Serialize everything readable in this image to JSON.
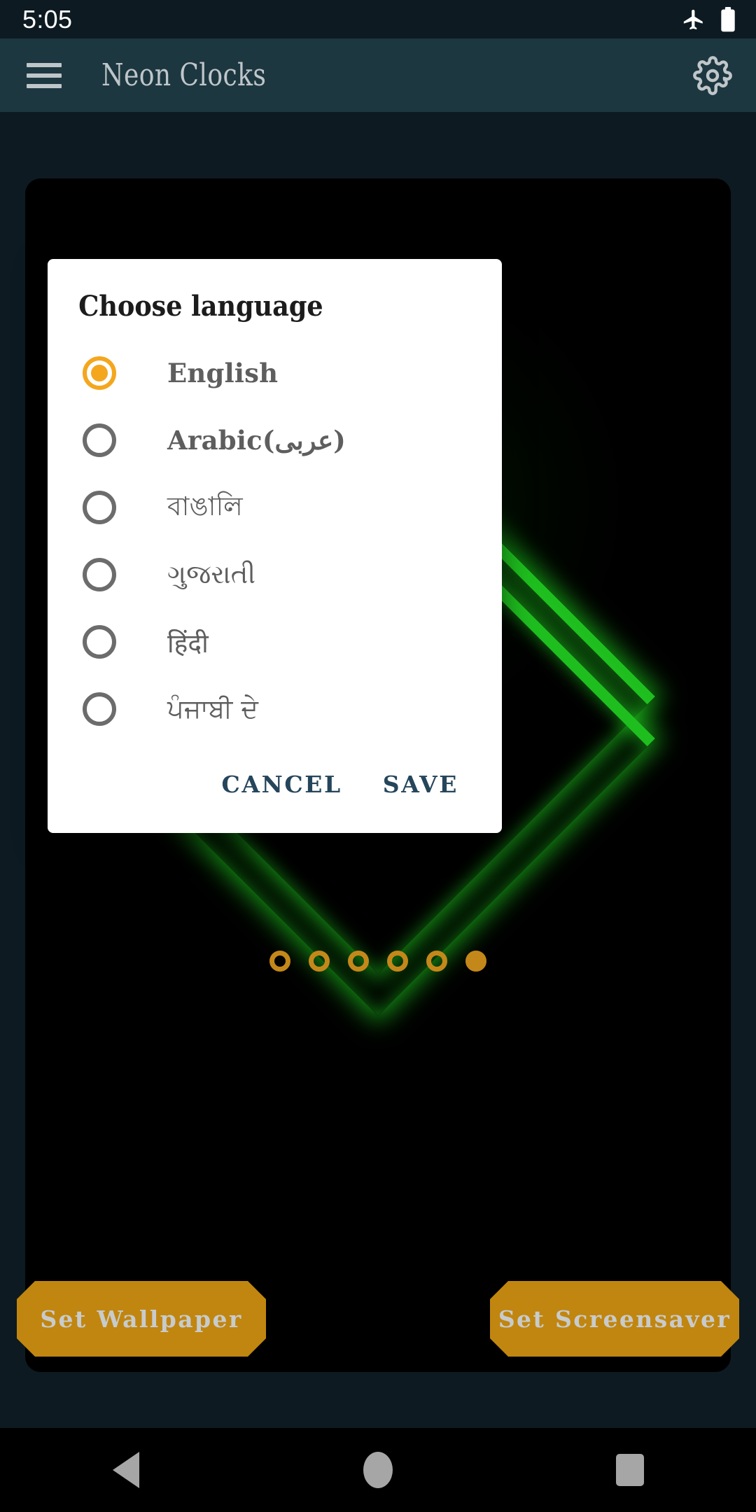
{
  "status_bar": {
    "time": "5:05",
    "icons": [
      "airplane-mode-icon",
      "battery-full-icon"
    ]
  },
  "app_bar": {
    "menu_icon": "hamburger-menu-icon",
    "title": "Neon Clocks",
    "settings_icon": "gear-icon"
  },
  "main": {
    "preview_card": {
      "artwork": "neon-green-chevron-clock"
    },
    "page_indicator": {
      "total": 6,
      "active_index": 5
    },
    "actions": {
      "set_wallpaper_label": "Set Wallpaper",
      "set_screensaver_label": "Set Screensaver"
    }
  },
  "dialog": {
    "title": "Choose language",
    "options": [
      {
        "label": "English",
        "selected": true,
        "script": "latin"
      },
      {
        "label": "Arabic(عربى)",
        "selected": false,
        "script": "latin"
      },
      {
        "label": "বাঙালি",
        "selected": false,
        "script": "native"
      },
      {
        "label": "ગુજરાતી",
        "selected": false,
        "script": "native"
      },
      {
        "label": "हिंदी",
        "selected": false,
        "script": "native"
      },
      {
        "label": "ਪੰਜਾਬੀ ਦੇ",
        "selected": false,
        "script": "native"
      }
    ],
    "cancel_label": "CANCEL",
    "save_label": "SAVE"
  },
  "nav_bar": {
    "back_label": "back-icon",
    "home_label": "home-icon",
    "recents_label": "recents-icon"
  },
  "colors": {
    "app_bar": "#1d3741",
    "background": "#0d1a21",
    "card": "#000000",
    "accent_amber": "#c4881a",
    "radio_selected": "#f4a71d",
    "dialog_action": "#25455b",
    "neon_green": "#1fbe1f"
  }
}
